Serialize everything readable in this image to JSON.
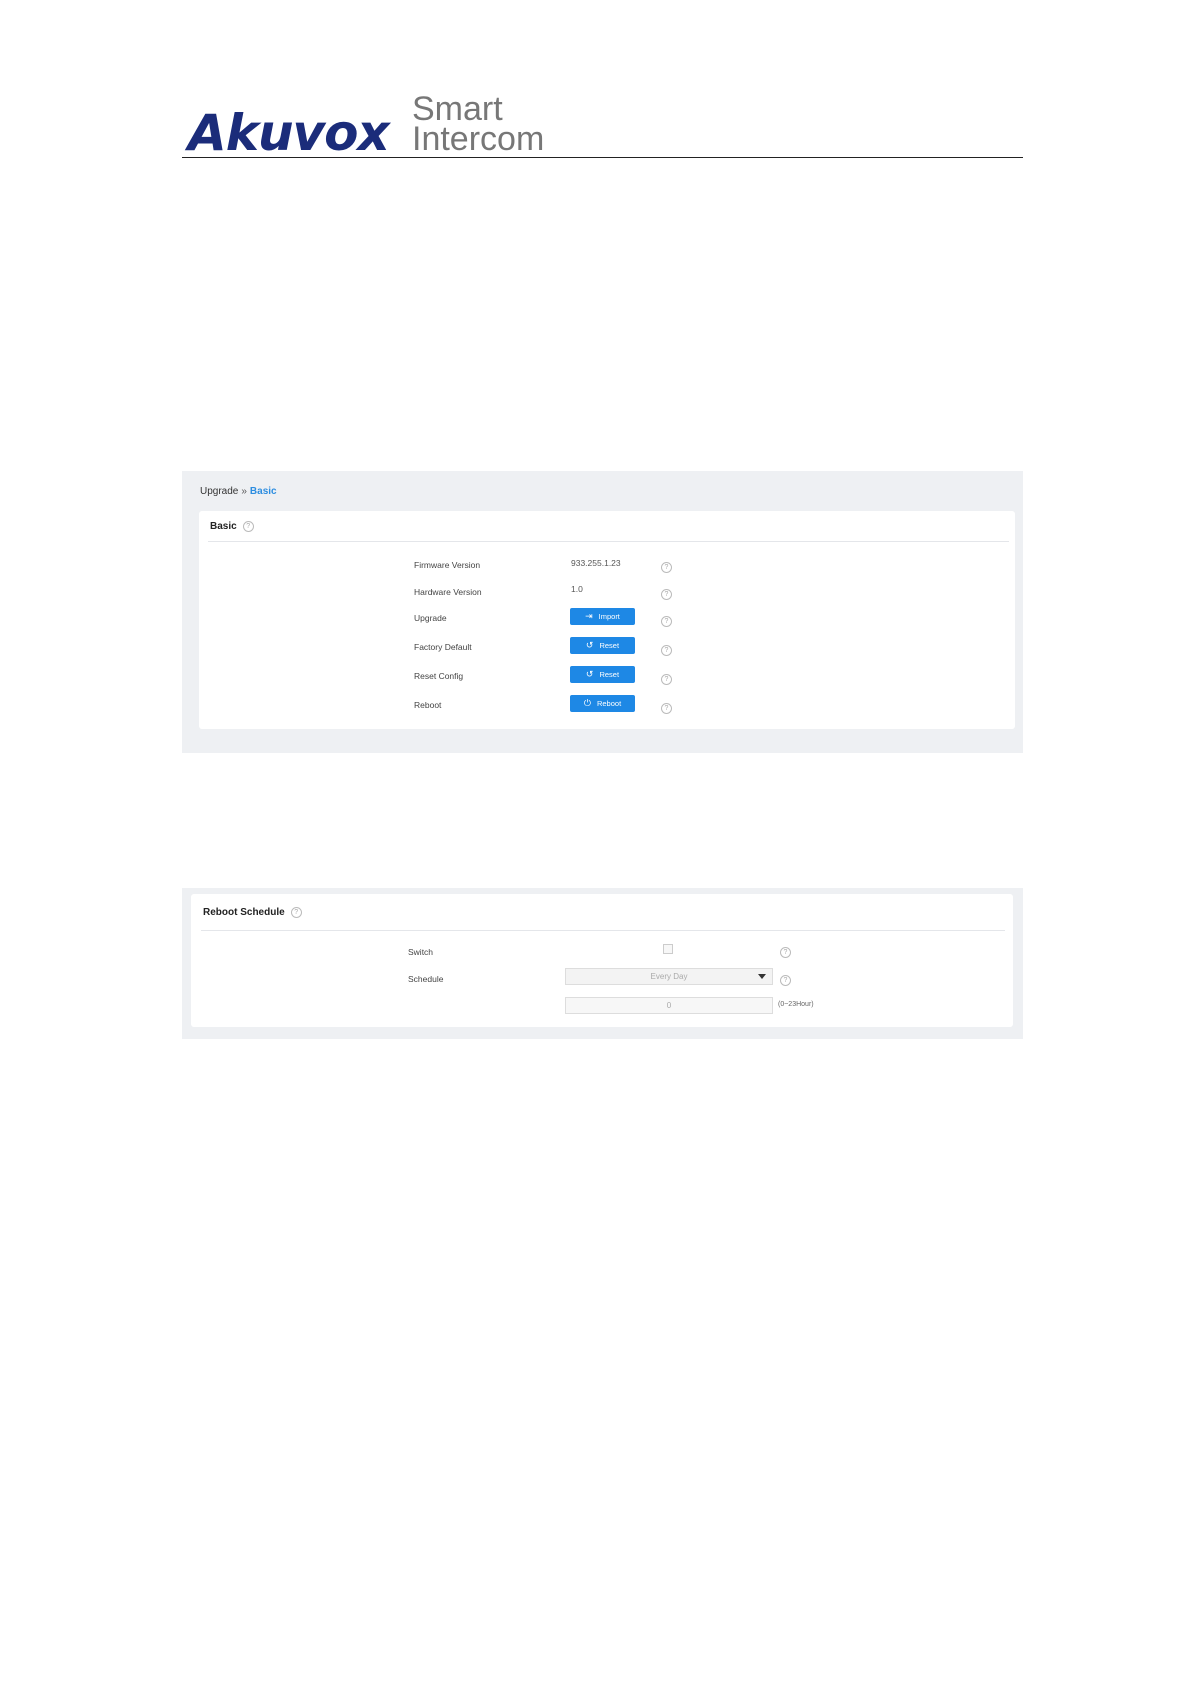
{
  "header": {
    "brand": "Akuvox",
    "sub_line1": "Smart",
    "sub_line2": "Intercom",
    "brand_color": "#1b2c7a"
  },
  "basic_panel": {
    "breadcrumb": {
      "parent": "Upgrade",
      "separator": "»",
      "current": "Basic"
    },
    "title": "Basic",
    "help_icon": "question-circle-icon",
    "rows": [
      {
        "label": "Firmware Version",
        "value": "933.255.1.23"
      },
      {
        "label": "Hardware Version",
        "value": "1.0"
      },
      {
        "label": "Upgrade",
        "button": "Import",
        "icon": "import-icon"
      },
      {
        "label": "Factory Default",
        "button": "Reset",
        "icon": "reset-icon"
      },
      {
        "label": "Reset Config",
        "button": "Reset",
        "icon": "reset-icon"
      },
      {
        "label": "Reboot",
        "button": "Reboot",
        "icon": "power-icon"
      }
    ],
    "button_color": "#1e88e5"
  },
  "reboot_schedule": {
    "title": "Reboot Schedule",
    "switch_label": "Switch",
    "switch_checked": false,
    "schedule_label": "Schedule",
    "schedule_value": "Every Day",
    "hour_value": "0",
    "hour_unit": "(0~23Hour)"
  }
}
